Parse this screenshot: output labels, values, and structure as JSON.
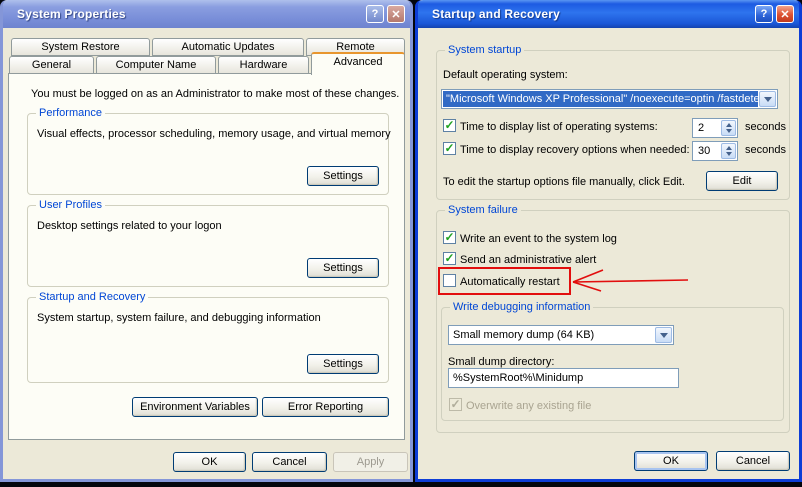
{
  "icons": {
    "check": "✓",
    "help": "?",
    "close": "✕"
  },
  "left_dialog": {
    "title": "System Properties",
    "tabs_row1": [
      "System Restore",
      "Automatic Updates",
      "Remote"
    ],
    "tabs_row2": [
      "General",
      "Computer Name",
      "Hardware",
      "Advanced"
    ],
    "active_tab": "Advanced",
    "admin_note": "You must be logged on as an Administrator to make most of these changes.",
    "groups": [
      {
        "caption": "Performance",
        "text": "Visual effects, processor scheduling, memory usage, and virtual memory",
        "button": "Settings"
      },
      {
        "caption": "User Profiles",
        "text": "Desktop settings related to your logon",
        "button": "Settings"
      },
      {
        "caption": "Startup and Recovery",
        "text": "System startup, system failure, and debugging information",
        "button": "Settings"
      }
    ],
    "env_button": "Environment Variables",
    "error_button": "Error Reporting",
    "ok": "OK",
    "cancel": "Cancel",
    "apply": "Apply"
  },
  "right_dialog": {
    "title": "Startup and Recovery",
    "system_startup": {
      "caption": "System startup",
      "default_os_label": "Default operating system:",
      "default_os_value": "\"Microsoft Windows XP Professional\" /noexecute=optin /fastdete",
      "time_list_label": "Time to display list of operating systems:",
      "time_list_value": "2",
      "time_recovery_label": "Time to display recovery options when needed:",
      "time_recovery_value": "30",
      "seconds": "seconds",
      "edit_note": "To edit the startup options file manually, click Edit.",
      "edit_button": "Edit"
    },
    "system_failure": {
      "caption": "System failure",
      "checkboxes": [
        {
          "label": "Write an event to the system log",
          "checked": true
        },
        {
          "label": "Send an administrative alert",
          "checked": true
        },
        {
          "label": "Automatically restart",
          "checked": false
        }
      ]
    },
    "write_debug": {
      "caption": "Write debugging information",
      "dump_type": "Small memory dump (64 KB)",
      "dir_label": "Small dump directory:",
      "dir_value": "%SystemRoot%\\Minidump",
      "overwrite_label": "Overwrite any existing file"
    },
    "ok": "OK",
    "cancel": "Cancel"
  },
  "colors": {
    "dialog_bg": "#ECE9D8",
    "active_title": "#1D5BE2",
    "inactive_title": "#7A8FD9",
    "group_caption": "#0046D5",
    "selection": "#316AC5",
    "tab_accent_orange": "#E8962E",
    "check_green": "#21A121",
    "annotation_red": "#E20E0E"
  }
}
